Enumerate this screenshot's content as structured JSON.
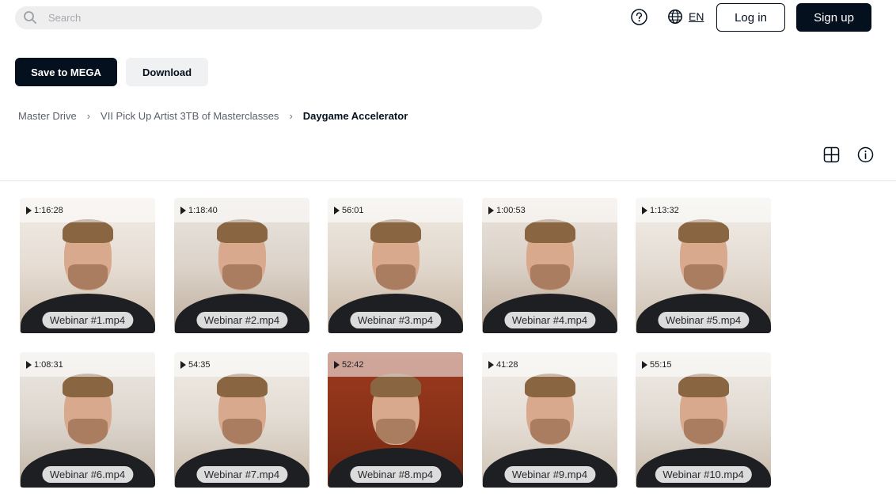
{
  "header": {
    "search_placeholder": "Search",
    "language": "EN",
    "login_label": "Log in",
    "signup_label": "Sign up"
  },
  "actions": {
    "save_label": "Save to MEGA",
    "download_label": "Download"
  },
  "breadcrumb": [
    "Master Drive",
    "VII Pick Up Artist 3TB of Masterclasses",
    "Daygame Accelerator"
  ],
  "colors": {
    "primary": "#04101e",
    "search_bg": "#eeeeee",
    "secondary_btn_bg": "#f0f1f2"
  },
  "icons": {
    "search": "search-icon",
    "help": "question-circle-icon",
    "language": "globe-icon",
    "view": "grid-view-icon",
    "info": "info-icon",
    "play": "play-icon"
  },
  "files": [
    {
      "name": "Webinar #1.mp4",
      "duration": "1:16:28"
    },
    {
      "name": "Webinar #2.mp4",
      "duration": "1:18:40"
    },
    {
      "name": "Webinar #3.mp4",
      "duration": "56:01"
    },
    {
      "name": "Webinar #4.mp4",
      "duration": "1:00:53"
    },
    {
      "name": "Webinar #5.mp4",
      "duration": "1:13:32"
    },
    {
      "name": "Webinar #6.mp4",
      "duration": "1:08:31"
    },
    {
      "name": "Webinar #7.mp4",
      "duration": "54:35"
    },
    {
      "name": "Webinar #8.mp4",
      "duration": "52:42"
    },
    {
      "name": "Webinar #9.mp4",
      "duration": "41:28"
    },
    {
      "name": "Webinar #10.mp4",
      "duration": "55:15"
    }
  ]
}
